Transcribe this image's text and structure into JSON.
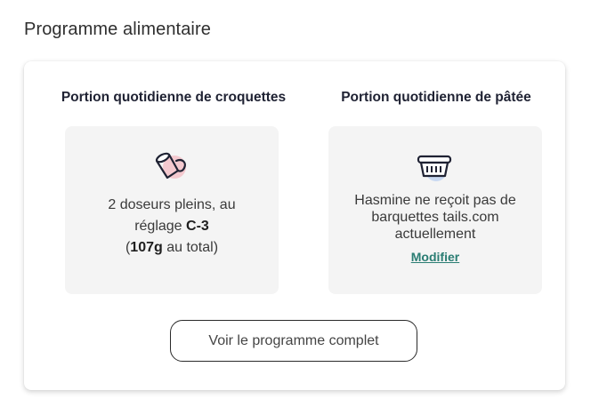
{
  "section": {
    "title": "Programme alimentaire"
  },
  "kibble": {
    "heading": "Portion quotidienne de croquettes",
    "icon": "scoop-icon",
    "line1": "2 doseurs pleins, au",
    "line2_prefix": "réglage ",
    "setting": "C-3",
    "line3_open": "(",
    "amount": "107g",
    "line3_suffix": " au total)"
  },
  "wet_food": {
    "heading": "Portion quotidienne de pâtée",
    "icon": "food-tray-icon",
    "message": "Hasmine ne reçoit pas de barquettes tails.com actuellement",
    "modify_label": "Modifier"
  },
  "actions": {
    "view_program_label": "Voir le programme complet"
  },
  "colors": {
    "link": "#2a7d73",
    "panel_bg": "#f4f4f4",
    "icon_accent_pink": "#f4c9cf",
    "icon_accent_blue": "#c9d9f2"
  }
}
